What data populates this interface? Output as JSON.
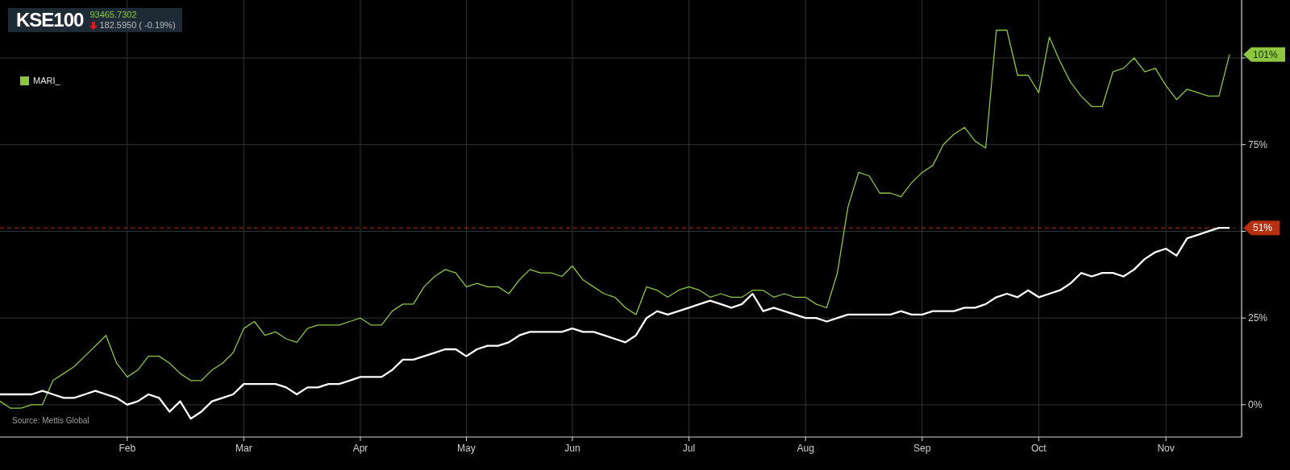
{
  "ticker": {
    "symbol": "KSE100",
    "price": "93465.7302",
    "change": "182.5950 ( -0.19%)",
    "down": true
  },
  "source": "Source: Mettis Global",
  "chart_data": {
    "type": "line",
    "categories": [
      null,
      null,
      null,
      null,
      null,
      null,
      null,
      null,
      null,
      null,
      null,
      null,
      "Feb",
      null,
      null,
      null,
      null,
      null,
      null,
      null,
      null,
      null,
      null,
      "Mar",
      null,
      null,
      null,
      null,
      null,
      null,
      null,
      null,
      null,
      null,
      "Apr",
      null,
      null,
      null,
      null,
      null,
      null,
      null,
      null,
      null,
      "May",
      null,
      null,
      null,
      null,
      null,
      null,
      null,
      null,
      null,
      "Jun",
      null,
      null,
      null,
      null,
      null,
      null,
      null,
      null,
      null,
      null,
      "Jul",
      null,
      null,
      null,
      null,
      null,
      null,
      null,
      null,
      null,
      null,
      "Aug",
      null,
      null,
      null,
      null,
      null,
      null,
      null,
      null,
      null,
      null,
      "Sep",
      null,
      null,
      null,
      null,
      null,
      null,
      null,
      null,
      null,
      null,
      "Oct",
      null,
      null,
      null,
      null,
      null,
      null,
      null,
      null,
      null,
      null,
      null,
      "Nov",
      null,
      null,
      null,
      null,
      null,
      null
    ],
    "series": [
      {
        "name": "MARI_",
        "color": "#8dc63f",
        "values": [
          1,
          -1,
          -1,
          0,
          0,
          7,
          9,
          11,
          14,
          17,
          20,
          12,
          8,
          10,
          14,
          14,
          12,
          9,
          7,
          7,
          10,
          12,
          15,
          22,
          24,
          20,
          21,
          19,
          18,
          22,
          23,
          23,
          23,
          24,
          25,
          23,
          23,
          27,
          29,
          29,
          34,
          37,
          39,
          38,
          34,
          35,
          34,
          34,
          32,
          36,
          39,
          38,
          38,
          37,
          40,
          36,
          34,
          32,
          31,
          28,
          26,
          34,
          33,
          31,
          33,
          34,
          33,
          31,
          32,
          31,
          31,
          33,
          33,
          31,
          32,
          31,
          31,
          29,
          28,
          38,
          57,
          67,
          66,
          61,
          61,
          60,
          64,
          67,
          69,
          75,
          78,
          80,
          76,
          74,
          108,
          108,
          95,
          95,
          90,
          106,
          99,
          93,
          89,
          86,
          86,
          96,
          97,
          100,
          96,
          97,
          92,
          88,
          91,
          90,
          89,
          89,
          101
        ]
      },
      {
        "color": "#ffffff",
        "values": [
          3,
          3,
          3,
          3,
          4,
          3,
          2,
          2,
          3,
          4,
          3,
          2,
          0,
          1,
          3,
          2,
          -2,
          1,
          -4,
          -2,
          1,
          2,
          3,
          6,
          6,
          6,
          6,
          5,
          3,
          5,
          5,
          6,
          6,
          7,
          8,
          8,
          8,
          10,
          13,
          13,
          14,
          15,
          16,
          16,
          14,
          16,
          17,
          17,
          18,
          20,
          21,
          21,
          21,
          21,
          22,
          21,
          21,
          20,
          19,
          18,
          20,
          25,
          27,
          26,
          27,
          28,
          29,
          30,
          29,
          28,
          29,
          32,
          27,
          28,
          27,
          26,
          25,
          25,
          24,
          25,
          26,
          26,
          26,
          26,
          26,
          27,
          26,
          26,
          27,
          27,
          27,
          28,
          28,
          29,
          31,
          32,
          31,
          33,
          31,
          32,
          33,
          35,
          38,
          37,
          38,
          38,
          37,
          39,
          42,
          44,
          45,
          43,
          48,
          49,
          50,
          51,
          51
        ]
      }
    ],
    "ylim": [
      -9.3,
      116.7
    ],
    "grid": true,
    "ref_lines": [
      {
        "axis": "y",
        "value": 51,
        "color": "#b8300f"
      }
    ],
    "yticks": [
      {
        "value": 0,
        "label": "0%"
      },
      {
        "value": 25,
        "label": "25%"
      },
      {
        "value": 75,
        "label": "75%"
      }
    ]
  },
  "value_tags": [
    {
      "label": "101%",
      "color": "#8dc63f"
    },
    {
      "label": "51%",
      "color": "#b8300f"
    }
  ]
}
